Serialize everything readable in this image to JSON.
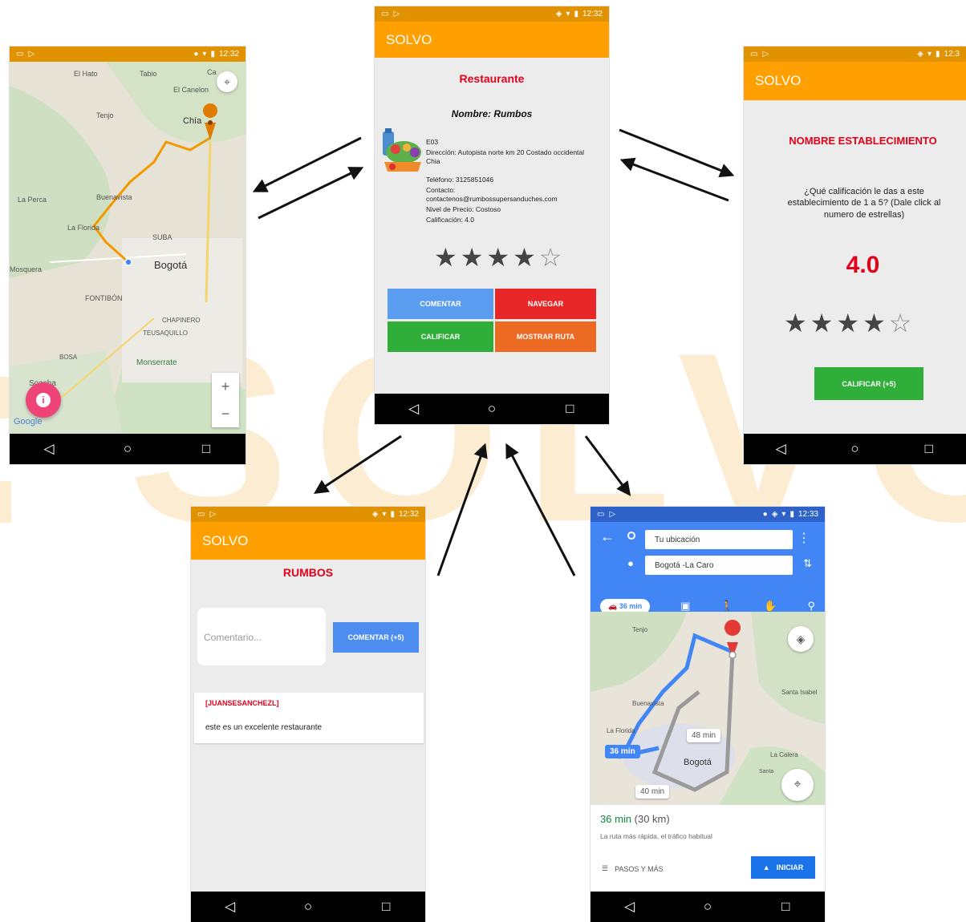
{
  "status_time_a": "12:32",
  "status_time_b": "12:33",
  "status_time_c": "12:3",
  "watermark": "SOLVO",
  "nav_icons": {
    "back": "◁",
    "home": "○",
    "recent": "□"
  },
  "map1": {
    "labels": [
      "El Hato",
      "Tabio",
      "Ca",
      "El Canelon",
      "Tenjo",
      "Chía",
      "La Perca",
      "Buenavista",
      "La Florida",
      "SUBA",
      "Mosquera",
      "Bogotá",
      "FONTIBÓN",
      "CHAPINERO",
      "TEUSAQUILLO",
      "BOSA",
      "Monserrate",
      "Soacha",
      "Google"
    ],
    "route_color": "#f29900",
    "zoom_in": "+",
    "zoom_out": "−",
    "info_button": "i"
  },
  "detail": {
    "app_title": "SOLVO",
    "section_title": "Restaurante",
    "name_line": "Nombre: Rumbos",
    "code": "E03",
    "address": "Dirección: Autopista norte km 20 Costado occidental Chia",
    "phone": "Teléfono: 3125851046",
    "contact_label": "Contacto:",
    "contact_email": "contactenos@rumbossupersanduches.com",
    "price_level": "Nivel de Precio: Costoso",
    "rating_line": "Calificación: 4.0",
    "rating_value": 4,
    "rating_max": 5,
    "buttons": {
      "comment": "COMENTAR",
      "navigate": "NAVEGAR",
      "rate": "CALIFICAR",
      "route": "MOSTRAR RUTA"
    },
    "colors": {
      "comment": "#5a9df0",
      "navigate": "#e82828",
      "rate": "#2fae3a",
      "route": "#ec6a22"
    }
  },
  "rate": {
    "app_title": "SOLVO",
    "title": "NOMBRE ESTABLECIMIENTO",
    "question": "¿Qué calificación le das a este establecimiento de 1 a 5? (Dale click al numero de estrellas)",
    "score": "4.0",
    "rating_value": 4,
    "button": "CALIFICAR (+5)"
  },
  "comments": {
    "app_title": "SOLVO",
    "title": "RUMBOS",
    "input_placeholder": "Comentario...",
    "button": "COMENTAR (+5)",
    "items": [
      {
        "user": "[JUANSESANCHEZL]",
        "text": "este es un excelente restaurante"
      }
    ]
  },
  "gmaps": {
    "origin": "Tu ubicación",
    "destination": "Bogotá -La Caro",
    "mode_time": "36 min",
    "map_labels": [
      "Tenjo",
      "Buenavista",
      "La Florida",
      "Bogotá",
      "Santa Isabel",
      "La Calera",
      "Santa"
    ],
    "route_badges": [
      "36 min",
      "48 min",
      "40 min"
    ],
    "summary_time": "36 min",
    "summary_distance": "(30 km)",
    "summary_note": "La ruta más rápida, el tráfico habitual",
    "steps_label": "PASOS Y MÁS",
    "start_label": "INICIAR"
  }
}
